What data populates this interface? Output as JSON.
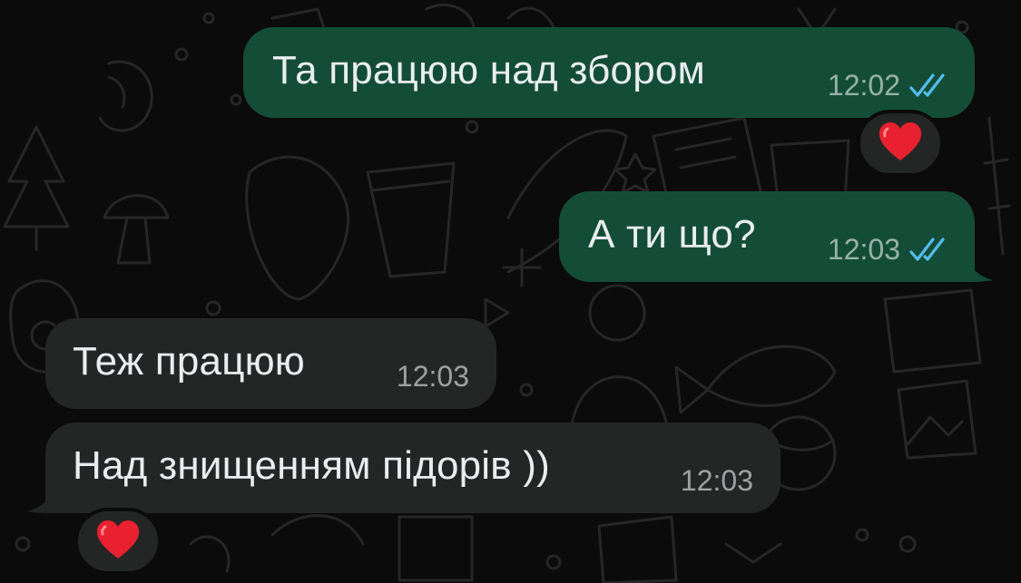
{
  "messages": [
    {
      "text": "Та працюю над збором",
      "time": "12:02",
      "direction": "outgoing",
      "status_icon": "double-check-read-icon",
      "reaction": "heart-emoji-icon"
    },
    {
      "text": "А ти що?",
      "time": "12:03",
      "direction": "outgoing",
      "status_icon": "double-check-read-icon"
    },
    {
      "text": "Теж працюю",
      "time": "12:03",
      "direction": "incoming"
    },
    {
      "text": "Над знищенням підорів ))",
      "time": "12:03",
      "direction": "incoming",
      "reaction": "heart-emoji-icon"
    }
  ],
  "colors": {
    "outgoing_bubble": "#144d37",
    "incoming_bubble": "#242626",
    "background": "#0b0b0b",
    "read_ticks": "#53bdeb",
    "reaction_heart": "#e8202f"
  }
}
